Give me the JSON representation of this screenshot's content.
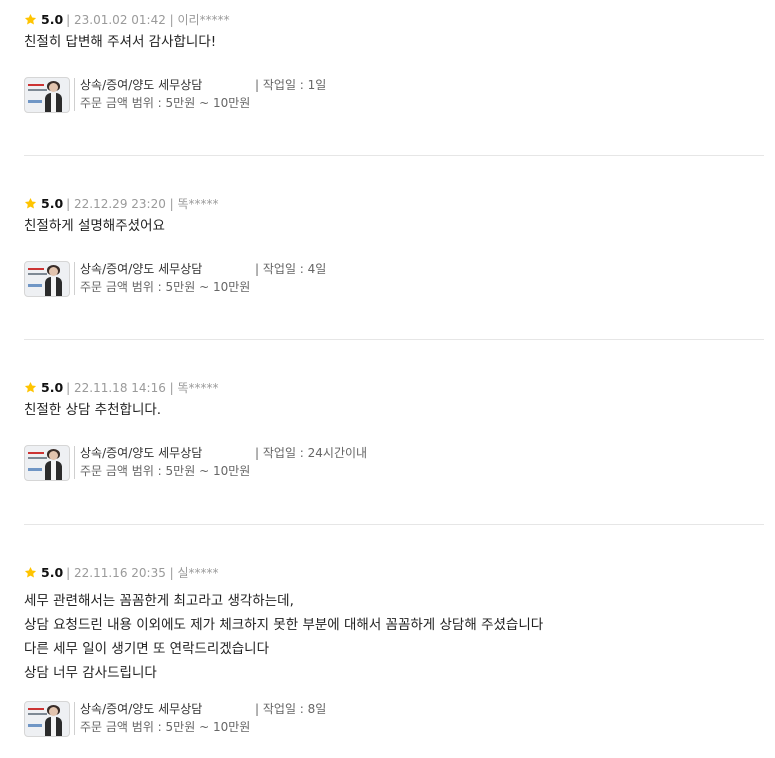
{
  "reviews": [
    {
      "rating": "5.0",
      "meta": "| 23.01.02 01:42 | 이리*****",
      "lines": [
        "친절히 답변해 주셔서 감사합니다!"
      ],
      "service_title": "상속/증여/양도 세무상담",
      "price_range": "주문 금액 범위 : 5만원 ~ 10만원",
      "work_period": "| 작업일 : 1일"
    },
    {
      "rating": "5.0",
      "meta": "| 22.12.29 23:20 | 똑*****",
      "lines": [
        "친절하게 설명해주셨어요"
      ],
      "service_title": "상속/증여/양도 세무상담",
      "price_range": "주문 금액 범위 : 5만원 ~ 10만원",
      "work_period": "| 작업일 : 4일"
    },
    {
      "rating": "5.0",
      "meta": "| 22.11.18 14:16 | 똑*****",
      "lines": [
        "친절한 상담 추천합니다."
      ],
      "service_title": "상속/증여/양도 세무상담",
      "price_range": "주문 금액 범위 : 5만원 ~ 10만원",
      "work_period": "| 작업일 : 24시간이내"
    },
    {
      "rating": "5.0",
      "meta": "| 22.11.16 20:35 | 실*****",
      "lines": [
        "세무 관련해서는 꼼꼼한게 최고라고 생각하는데,",
        "상담 요청드린 내용 이외에도 제가 체크하지 못한 부분에 대해서 꼼꼼하게 상담해 주셨습니다",
        "다른 세무 일이 생기면 또 연락드리겠습니다",
        "상담 너무 감사드립니다"
      ],
      "service_title": "상속/증여/양도 세무상담",
      "price_range": "주문 금액 범위 : 5만원 ~ 10만원",
      "work_period": "| 작업일 : 8일"
    }
  ],
  "icons": {
    "star": "star-icon",
    "thumbnail": "service-thumbnail"
  },
  "colors": {
    "star": "#FFC400",
    "meta": "#9A9A9A",
    "divider": "#E6E6E6"
  }
}
